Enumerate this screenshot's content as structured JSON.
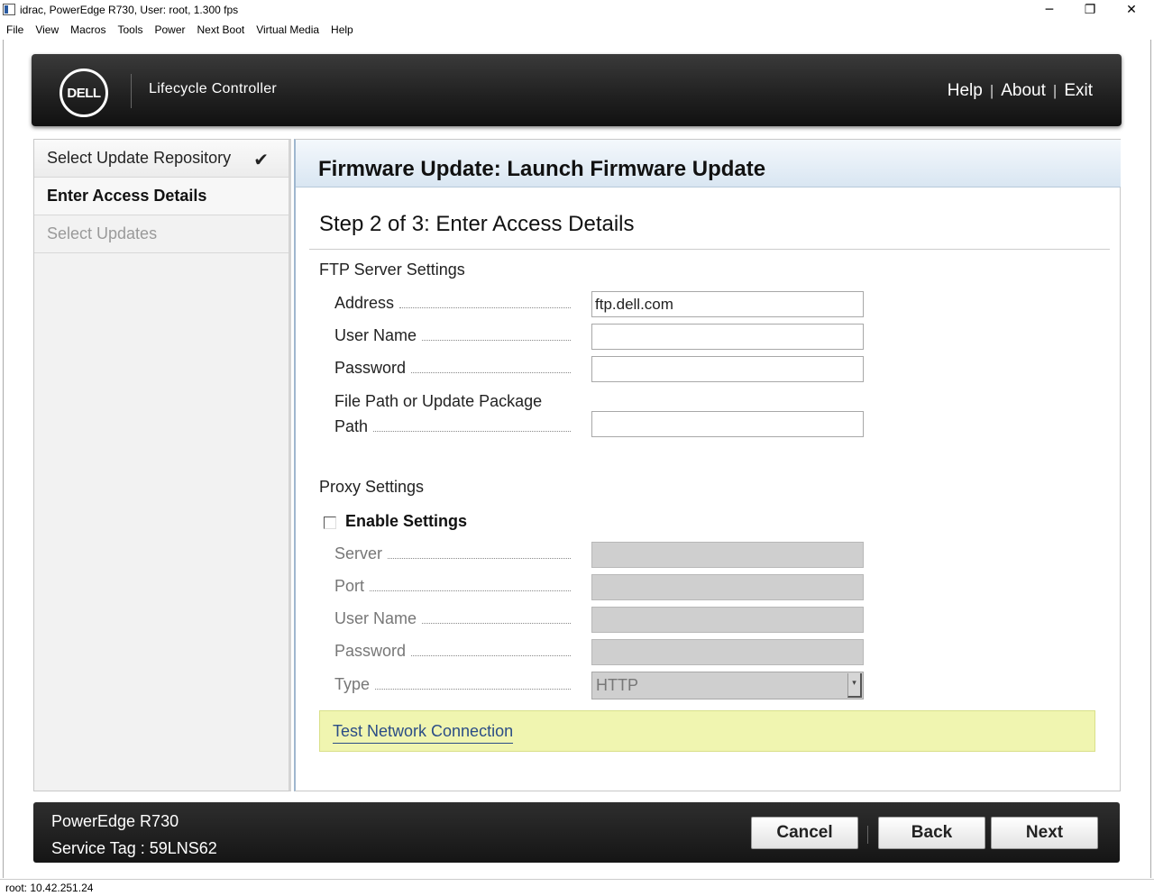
{
  "window": {
    "title": "idrac, PowerEdge R730, User: root, 1.300 fps",
    "minimize_glyph": "─",
    "maximize_glyph": "❐",
    "close_glyph": "✕"
  },
  "menu": {
    "items": [
      "File",
      "View",
      "Macros",
      "Tools",
      "Power",
      "Next Boot",
      "Virtual Media",
      "Help"
    ]
  },
  "header": {
    "logo": "DELL",
    "app_name": "Lifecycle Controller",
    "links": [
      "Help",
      "About",
      "Exit"
    ],
    "separator": "|"
  },
  "sidebar": {
    "items": [
      {
        "label": "Select Update Repository",
        "state": "done"
      },
      {
        "label": "Enter Access Details",
        "state": "active"
      },
      {
        "label": "Select Updates",
        "state": "disabled"
      }
    ],
    "check_glyph": "✔"
  },
  "main": {
    "title": "Firmware Update: Launch Firmware Update",
    "step": "Step 2 of 3: Enter  Access Details",
    "ftp": {
      "heading": "FTP Server Settings",
      "address_label": "Address",
      "address_value": "ftp.dell.com",
      "username_label": "User Name",
      "username_value": "",
      "password_label": "Password",
      "password_value": "",
      "path_label_line1": "File Path or Update Package",
      "path_label_line2": "Path",
      "path_value": ""
    },
    "proxy": {
      "heading": "Proxy Settings",
      "enable_label": "Enable Settings",
      "enable_checked": false,
      "server_label": "Server",
      "port_label": "Port",
      "username_label": "User Name",
      "password_label": "Password",
      "type_label": "Type",
      "type_value": "HTTP",
      "select_arrow_glyph": "▾"
    },
    "test_link": "Test Network Connection"
  },
  "footer": {
    "model": "PowerEdge R730",
    "service_tag": "Service Tag : 59LNS62",
    "buttons": {
      "cancel": "Cancel",
      "back": "Back",
      "next": "Next"
    }
  },
  "statusbar": {
    "text": "root: 10.42.251.24"
  }
}
